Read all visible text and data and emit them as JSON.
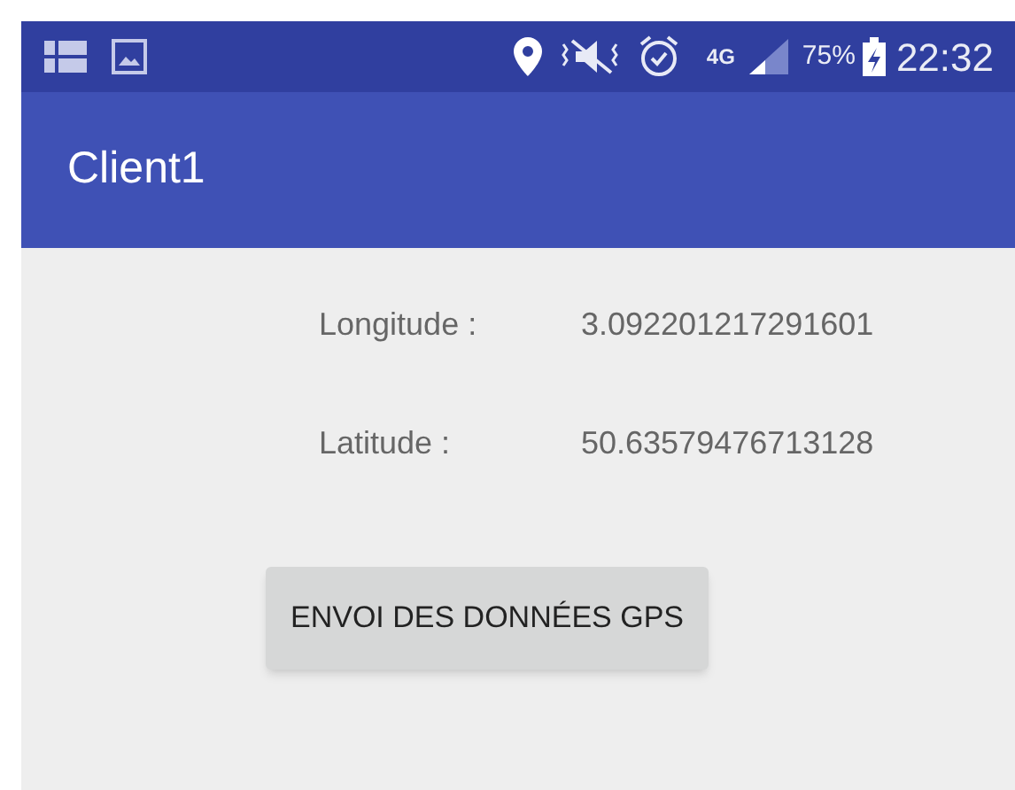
{
  "status_bar": {
    "network": "4G",
    "battery": "75%",
    "time": "22:32"
  },
  "app_bar": {
    "title": "Client1"
  },
  "fields": [
    {
      "label": "Longitude :",
      "value": "3.092201217291601"
    },
    {
      "label": "Latitude :",
      "value": "50.63579476713128"
    }
  ],
  "button": "ENVOI DES DONNÉES GPS"
}
